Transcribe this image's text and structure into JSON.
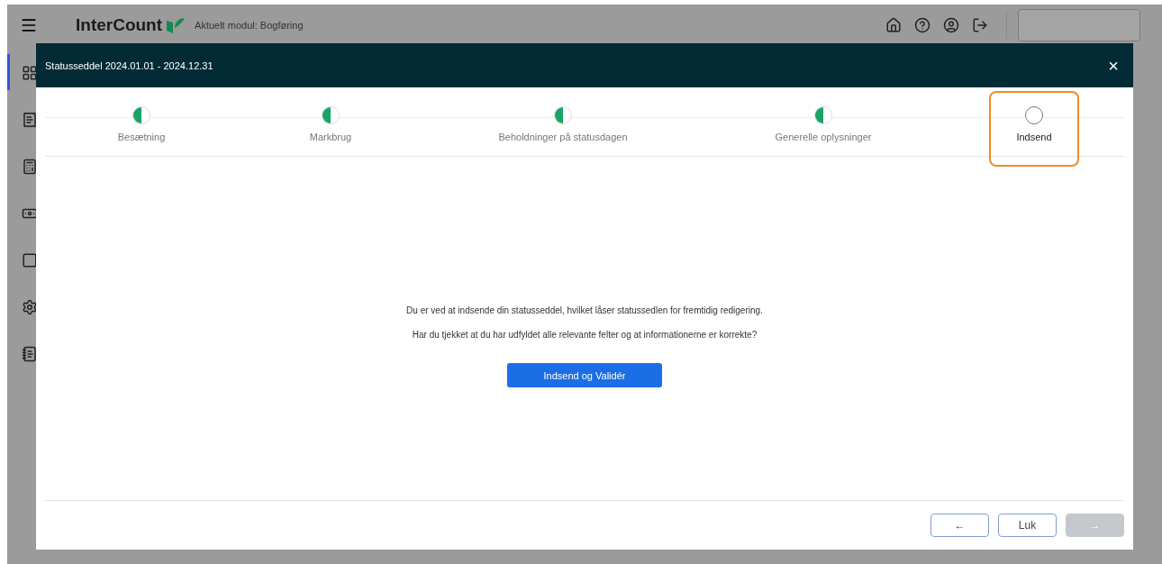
{
  "app": {
    "brand": "InterCount",
    "module": "Aktuelt modul: Bogføring"
  },
  "dialog": {
    "title": "Statusseddel 2024.01.01 - 2024.12.31",
    "close": "×",
    "steps": [
      {
        "label": "Besætning",
        "kind": "partial",
        "selected": false
      },
      {
        "label": "Markbrug",
        "kind": "partial",
        "selected": false
      },
      {
        "label": "Beholdninger på statusdagen",
        "kind": "partial",
        "selected": false
      },
      {
        "label": "Generelle oplysninger",
        "kind": "partial",
        "selected": false
      },
      {
        "label": "Indsend",
        "kind": "empty",
        "selected": true
      }
    ],
    "messages": [
      "Du er ved at indsende din statusseddel, hvilket låser statussedlen for fremtidig redigering.",
      "Har du tjekket at du har udfyldet alle relevante felter og at informationerne er korrekte?"
    ],
    "submit": "Indsend og Validér",
    "footer": [
      {
        "label": "←",
        "disabled": false
      },
      {
        "label": "Luk",
        "disabled": false
      },
      {
        "label": "→",
        "disabled": true
      }
    ]
  }
}
